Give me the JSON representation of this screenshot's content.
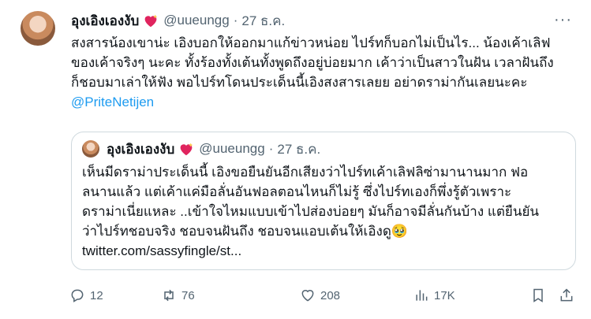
{
  "tweet": {
    "author_name": "อุงเอิงเองงับ",
    "handle": "@uueungg",
    "separator": "·",
    "date": "27 ธ.ค.",
    "more_label": "···",
    "text_line1": "สงสารน้องเขาน่ะ เอิงบอกให้ออกมาแก้ข่าวหน่อย ไปร์ทก็บอกไม่เป็นไร... น้องเค้าเลิฟ",
    "text_line2": "ของเค้าจริงๆ นะคะ ทั้งร้องทั้งเต้นทั้งพูดถึงอยู่บ่อยมาก เค้าว่าเป็นสาวในฝัน เวลาฝันถึง",
    "text_line3": "ก็ชอบมาเล่าให้ฟัง พอไปร์ทโดนประเด็นนี้เอิงสงสารเลยย อย่าดราม่ากันเลยนะคะ",
    "mention": "@PriteNetijen"
  },
  "quote": {
    "author_name": "อุงเอิงเองงับ",
    "handle": "@uueungg",
    "separator": "·",
    "date": "27 ธ.ค.",
    "line1": "เห็นมีดราม่าประเด็นนี้ เอิงขอยืนยันอีกเสียงว่าไปร์ทเค้าเลิฟลิซ่ามานานมาก ฟอ",
    "line2": "ลนานแล้ว แต่เค้าแค่มือลั่นอันฟอลตอนไหนก็ไม่รู้ ซึ่งไปร์ทเองก็พึ่งรู้ตัวเพราะ",
    "line3": "ดราม่าเนี่ยแหละ  ..เข้าใจไหมแบบเข้าไปส่องบ่อยๆ มันก็อาจมีลั่นกันบ้าง แต่ยืนยัน",
    "line4": "ว่าไปร์ทชอบจริง ชอบจนฝันถึง ชอบจนแอบเต้นให้เอิงดู🥹",
    "link": "twitter.com/sassyfingle/st..."
  },
  "actions": {
    "replies": "12",
    "reposts": "76",
    "likes": "208",
    "views": "17K"
  },
  "colors": {
    "accent": "#1d9bf0",
    "muted": "#536471",
    "border": "#cfd9de"
  }
}
